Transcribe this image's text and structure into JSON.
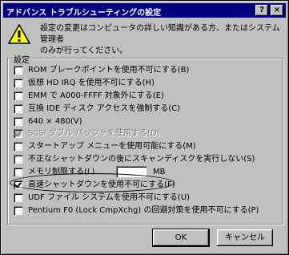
{
  "window": {
    "title": "アドバンス トラブルシューティングの設定",
    "help_label": "?",
    "close_label": "×"
  },
  "warning": {
    "icon": "warning-icon",
    "text_line1": "設定の変更はコンピュータの詳しい知識がある方、またはシステム管理者",
    "text_line2": "のみが行ってください。"
  },
  "group": {
    "label": "設定"
  },
  "options": [
    {
      "label": "ROM ブレークポイントを使用不可にする(B)",
      "checked": false,
      "disabled": false
    },
    {
      "label": "仮想 HD IRQ を使用不可にする(H)",
      "checked": false,
      "disabled": false
    },
    {
      "label": "EMM で A000-FFFF 対象外にする(E)",
      "checked": false,
      "disabled": false
    },
    {
      "label": "互換 IDE ディスク アクセスを強制する(C)",
      "checked": false,
      "disabled": false
    },
    {
      "label": "640 × 480(V)",
      "checked": false,
      "disabled": false
    },
    {
      "label": "SCSI ダブル バッファを使用する(D)",
      "checked": true,
      "disabled": true
    },
    {
      "label": "スタートアップ メニューを使用可能にする(M)",
      "checked": false,
      "disabled": false
    },
    {
      "label": "不正なシャットダウンの後にスキャンディスクを実行しない(S)",
      "checked": false,
      "disabled": false
    },
    {
      "label": "メモリ制限する(L)",
      "checked": false,
      "disabled": false,
      "value": "",
      "unit": "MB"
    },
    {
      "label": "高速シャットダウンを使用不可にする(F)",
      "checked": true,
      "disabled": false
    },
    {
      "label": "UDF ファイル システムを使用不可にする(U)",
      "checked": false,
      "disabled": false
    },
    {
      "label": "Pentium F0 (Lock CmpXchg) の回避対策を使用不可にする(P)",
      "checked": false,
      "disabled": false
    }
  ],
  "buttons": {
    "ok": "OK",
    "cancel": "キャンセル"
  }
}
